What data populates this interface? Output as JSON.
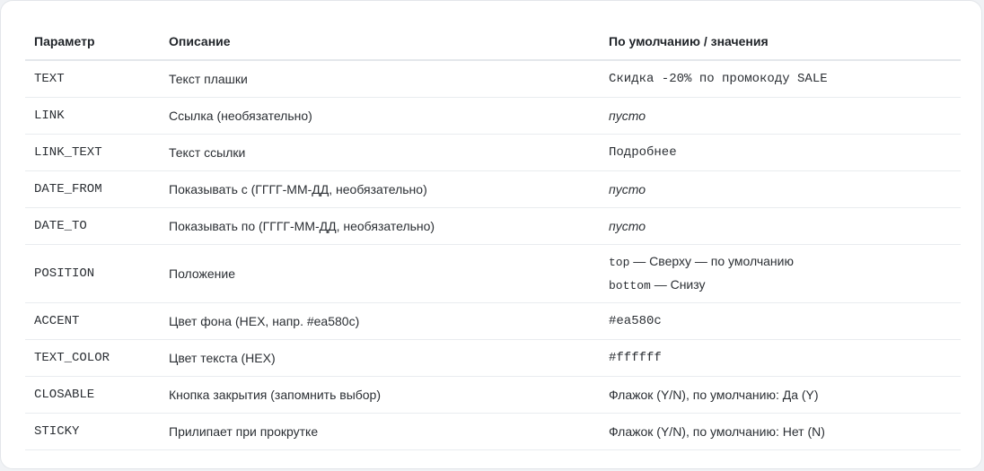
{
  "headers": {
    "param": "Параметр",
    "description": "Описание",
    "default": "По умолчанию / значения"
  },
  "rows": [
    {
      "param": "TEXT",
      "description": "Текст плашки",
      "default": "Скидка -20% по промокоду SALE"
    },
    {
      "param": "LINK",
      "description": "Ссылка (необязательно)",
      "default": "пусто"
    },
    {
      "param": "LINK_TEXT",
      "description": "Текст ссылки",
      "default": "Подробнее"
    },
    {
      "param": "DATE_FROM",
      "description": "Показывать с (ГГГГ-ММ-ДД, необязательно)",
      "default": "пусто"
    },
    {
      "param": "DATE_TO",
      "description": "Показывать по (ГГГГ-ММ-ДД, необязательно)",
      "default": "пусто"
    },
    {
      "param": "POSITION",
      "description": "Положение",
      "options": [
        {
          "code": "top",
          "text": " — Сверху — по умолчанию"
        },
        {
          "code": "bottom",
          "text": " — Снизу"
        }
      ]
    },
    {
      "param": "ACCENT",
      "description": "Цвет фона (HEX, напр. #ea580c)",
      "default": "#ea580c"
    },
    {
      "param": "TEXT_COLOR",
      "description": "Цвет текста (HEX)",
      "default": "#ffffff"
    },
    {
      "param": "CLOSABLE",
      "description": "Кнопка закрытия (запомнить выбор)",
      "default": "Флажок (Y/N), по умолчанию: Да (Y)"
    },
    {
      "param": "STICKY",
      "description": "Прилипает при прокрутке",
      "default": "Флажок (Y/N), по умолчанию: Нет (N)"
    }
  ]
}
